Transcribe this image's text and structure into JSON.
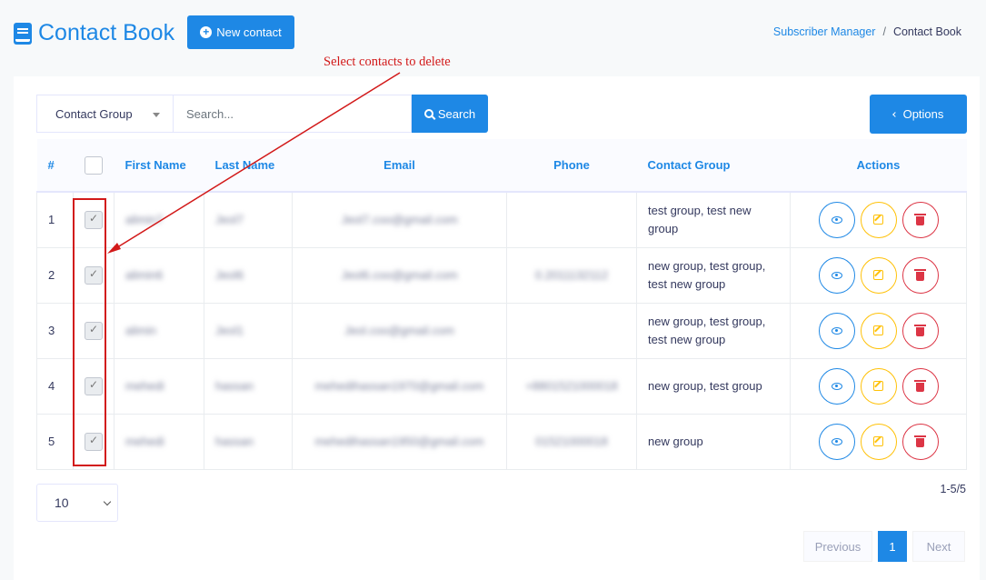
{
  "header": {
    "title": "Contact Book",
    "new_contact_label": "New contact",
    "breadcrumb": {
      "parent": "Subscriber Manager",
      "separator": "/",
      "current": "Contact Book"
    }
  },
  "annotation": {
    "text": "Select contacts to delete",
    "color": "#d21919"
  },
  "filter": {
    "group_select_label": "Contact Group",
    "search_placeholder": "Search...",
    "search_button_label": "Search",
    "options_button_label": "Options"
  },
  "table": {
    "headers": {
      "num": "#",
      "first_name": "First Name",
      "last_name": "Last Name",
      "email": "Email",
      "phone": "Phone",
      "group": "Contact Group",
      "actions": "Actions"
    },
    "rows": [
      {
        "num": "1",
        "first_name": "alimin7",
        "last_name": "Jeol7",
        "email": "Jeol7.coo@gmail.com",
        "phone": "",
        "group": "test group, test new group",
        "checked": true
      },
      {
        "num": "2",
        "first_name": "alimin6",
        "last_name": "Jeol6",
        "email": "Jeol6.coo@gmail.com",
        "phone": "0.2011132112",
        "group": "new group, test group, test new group",
        "checked": true
      },
      {
        "num": "3",
        "first_name": "alimin",
        "last_name": "Jeol1",
        "email": "Jeol.coo@gmail.com",
        "phone": "",
        "group": "new group, test group, test new group",
        "checked": true
      },
      {
        "num": "4",
        "first_name": "mehedi",
        "last_name": "hassan",
        "email": "mehedihassan1970@gmail.com",
        "phone": "+8801521000018",
        "group": "new group, test group",
        "checked": true
      },
      {
        "num": "5",
        "first_name": "mehedi",
        "last_name": "hassan",
        "email": "mehedihassan1950@gmail.com",
        "phone": "01521000018",
        "group": "new group",
        "checked": true
      }
    ]
  },
  "footer": {
    "page_size": "10",
    "range": "1-5/5",
    "pagination": {
      "previous": "Previous",
      "current_page": "1",
      "next": "Next"
    }
  },
  "colors": {
    "primary": "#1e88e5",
    "warning": "#ffc107",
    "danger": "#dc3545"
  }
}
